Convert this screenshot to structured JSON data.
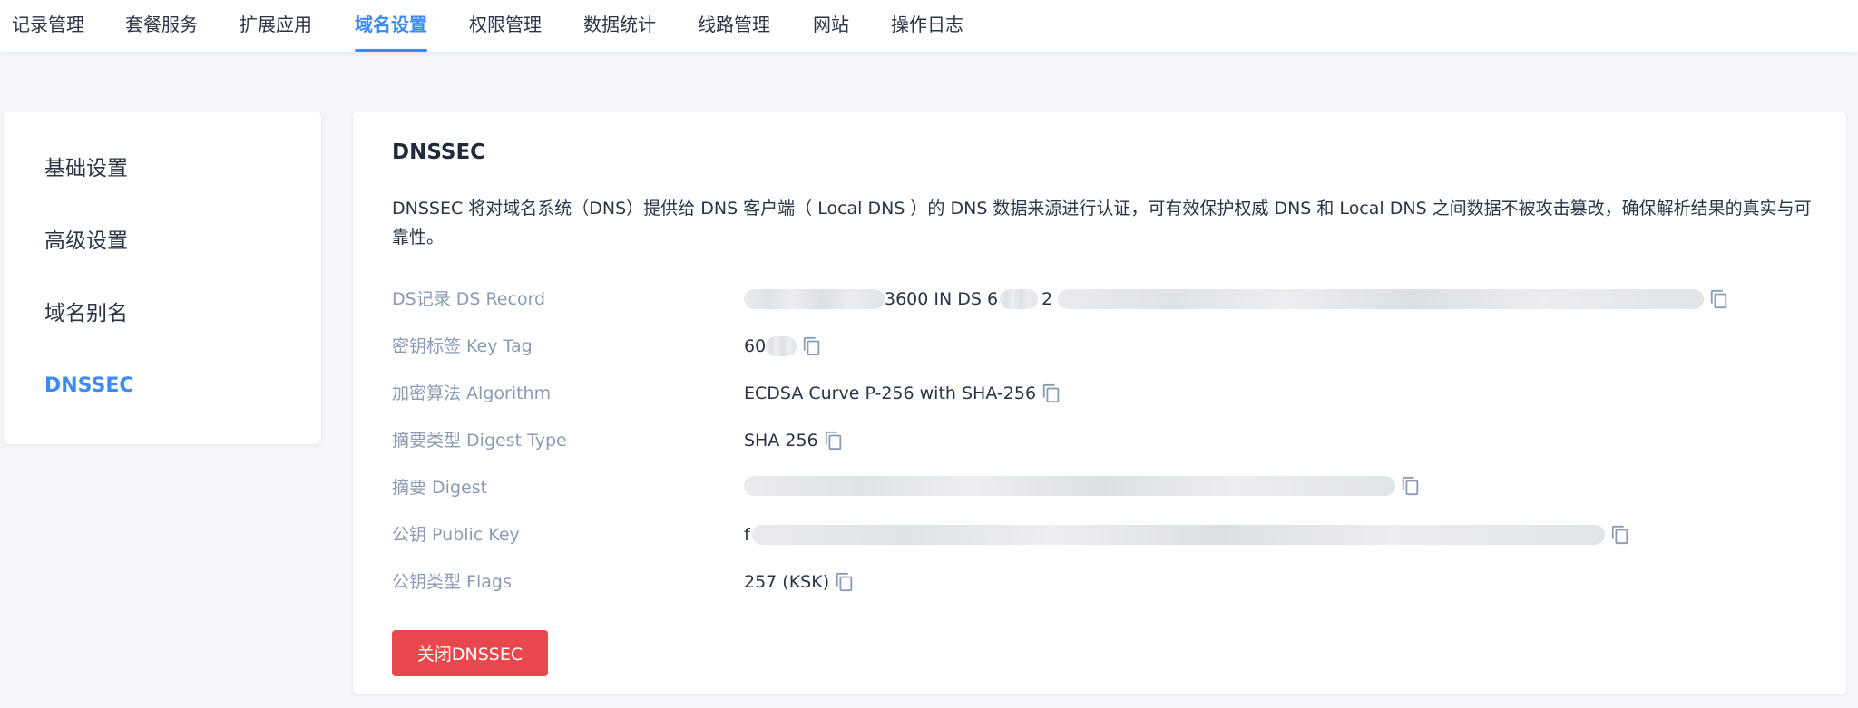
{
  "nav": {
    "tabs": [
      {
        "label": "记录管理"
      },
      {
        "label": "套餐服务"
      },
      {
        "label": "扩展应用"
      },
      {
        "label": "域名设置"
      },
      {
        "label": "权限管理"
      },
      {
        "label": "数据统计"
      },
      {
        "label": "线路管理"
      },
      {
        "label": "网站"
      },
      {
        "label": "操作日志"
      }
    ],
    "active": "域名设置"
  },
  "sidebar": {
    "items": [
      {
        "label": "基础设置"
      },
      {
        "label": "高级设置"
      },
      {
        "label": "域名别名"
      },
      {
        "label": "DNSSEC"
      }
    ],
    "active": "DNSSEC"
  },
  "main": {
    "title": "DNSSEC",
    "description": "DNSSEC 将对域名系统（DNS）提供给 DNS 客户端（ Local DNS ）的 DNS 数据来源进行认证，可有效保护权威 DNS 和 Local DNS 之间数据不被攻击篡改，确保解析结果的真实与可靠性。",
    "fields": [
      {
        "label": "DS记录 DS Record",
        "value_parts": [
          "3600 IN DS 6",
          "2"
        ]
      },
      {
        "label": "密钥标签 Key Tag",
        "value_parts": [
          "60"
        ]
      },
      {
        "label": "加密算法 Algorithm",
        "value_parts": [
          "ECDSA Curve P-256 with SHA-256"
        ]
      },
      {
        "label": "摘要类型 Digest Type",
        "value_parts": [
          "SHA 256"
        ]
      },
      {
        "label": "摘要 Digest",
        "value_parts": []
      },
      {
        "label": "公钥 Public Key",
        "value_parts": [
          "f"
        ]
      },
      {
        "label": "公钥类型 Flags",
        "value_parts": [
          "257 (KSK)"
        ]
      }
    ],
    "disable_button_label": "关闭DNSSEC"
  },
  "icons": {
    "copy": "copy-icon"
  },
  "colors": {
    "accent": "#3d8af7",
    "danger": "#e8484d",
    "label": "#8b9bb4"
  }
}
